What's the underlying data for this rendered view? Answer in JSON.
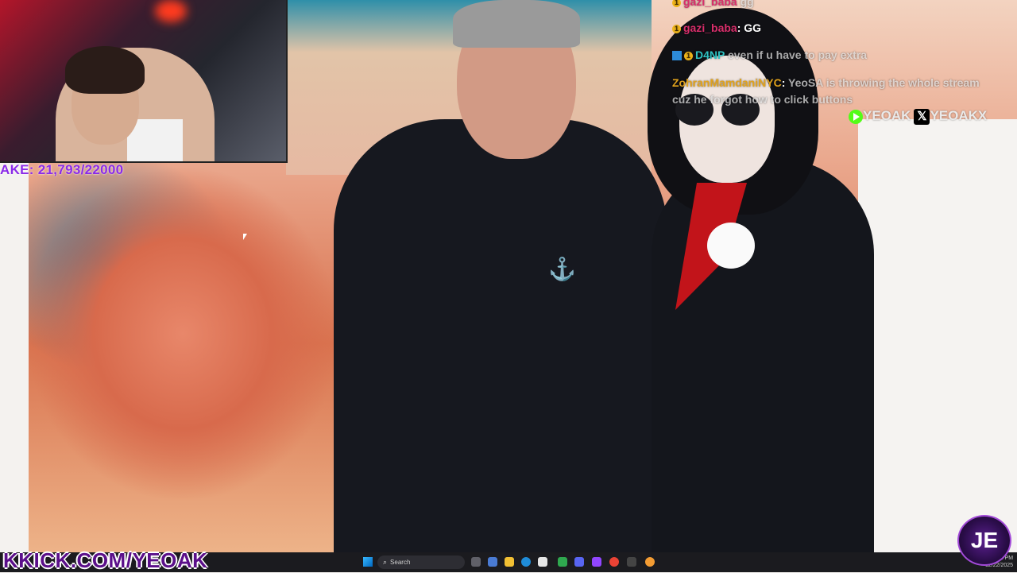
{
  "goal": {
    "text": "AKE: 21,793/22000"
  },
  "chat": {
    "lines": [
      {
        "user": "gazi_baba",
        "user_color": "#d92e6b",
        "text": "gg",
        "badge": "1"
      },
      {
        "user": "gazi_baba",
        "user_color": "#d92e6b",
        "text": "GG",
        "badge": "1"
      },
      {
        "user": "D4NP",
        "user_color": "#2ec2c2",
        "text": "even if u have to pay extra",
        "badge": "1"
      },
      {
        "user": "ZohranMamdaniNYC",
        "user_color": "#e0a21d",
        "text": "YeoSA is throwing the whole stream",
        "badge": ""
      },
      {
        "user": "",
        "user_color": "#ffffff",
        "text": "cuz he forgot how to click buttons",
        "badge": ""
      }
    ]
  },
  "socials": {
    "kick": "YEOAK",
    "x": "YEOAKX"
  },
  "overlay": {
    "kick_url_prefix": "K",
    "kick_url": "KICK.COM/YEOAK"
  },
  "taskbar": {
    "search_placeholder": "Search",
    "time": "11:52 PM",
    "date": "12/22/2025"
  },
  "logo": {
    "text": "JE"
  },
  "colors": {
    "goal": "#8b2be8",
    "kick_green": "#53fc18",
    "brand_purple": "#5b0f8a"
  }
}
